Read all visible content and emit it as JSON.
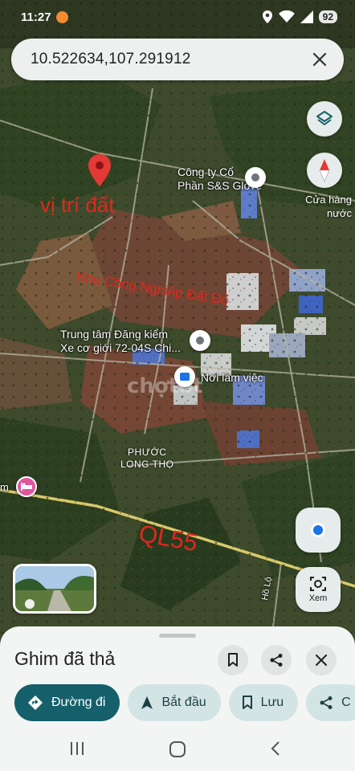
{
  "status_bar": {
    "time": "11:27",
    "battery": "92"
  },
  "search": {
    "query": "10.522634,107.291912"
  },
  "map": {
    "poi_labels": {
      "company": "Công ty Cổ\nPhần S&S Glove",
      "inspection": "Trung tâm Đăng kiểm\nXe cơ giới 72-04S Chi...",
      "workplace": "Nơi làm việc",
      "water_shop": "Cửa hàng\nnước"
    },
    "area_label": "PHƯỚC\nLONG THỌ",
    "road_label": "Hồ Lộ",
    "edge_label": "m",
    "annotations": {
      "site": "vị trí đất",
      "zone": "Khu Công Nghiệp Đất Đỏ",
      "road": "QL55"
    },
    "watermark": "chợtốt"
  },
  "controls": {
    "view_label": "Xem"
  },
  "sheet": {
    "title": "Ghim đã thả",
    "chips": [
      {
        "label": "Đường đi",
        "icon": "directions-icon"
      },
      {
        "label": "Bắt đầu",
        "icon": "navigation-arrow-icon"
      },
      {
        "label": "Lưu",
        "icon": "bookmark-icon"
      },
      {
        "label": "C",
        "icon": "share-icon"
      }
    ]
  },
  "colors": {
    "accent": "#15606a",
    "chip": "#d3e4e4",
    "annotation": "#e0281e",
    "pin": "#ea4335"
  }
}
